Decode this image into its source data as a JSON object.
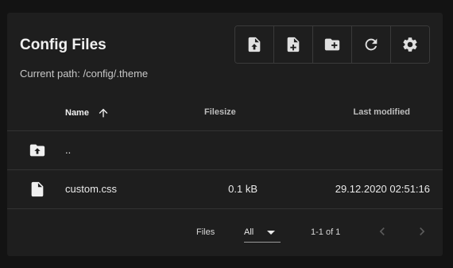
{
  "header": {
    "title": "Config Files",
    "current_path": "Current path: /config/.theme"
  },
  "toolbar": {
    "buttons": [
      {
        "name": "upload-file",
        "icon": "file-upload-icon"
      },
      {
        "name": "new-file",
        "icon": "file-plus-icon"
      },
      {
        "name": "new-folder",
        "icon": "folder-plus-icon"
      },
      {
        "name": "refresh",
        "icon": "refresh-icon"
      },
      {
        "name": "settings",
        "icon": "gear-icon"
      }
    ]
  },
  "table": {
    "columns": {
      "name": "Name",
      "filesize": "Filesize",
      "last_modified": "Last modified"
    },
    "sort": {
      "column": "name",
      "direction": "ascending",
      "icon": "arrow-up-icon"
    },
    "rows": [
      {
        "type": "folder-up",
        "icon": "folder-up-icon",
        "name": "..",
        "filesize": "",
        "last_modified": ""
      },
      {
        "type": "file",
        "icon": "file-icon",
        "name": "custom.css",
        "filesize": "0.1 kB",
        "last_modified": "29.12.2020 02:51:16"
      }
    ]
  },
  "pagination": {
    "label": "Files",
    "per_page_selected": "All",
    "range": "1-1 of 1",
    "prev_icon": "chevron-left-icon",
    "next_icon": "chevron-right-icon"
  },
  "colors": {
    "background": "#131313",
    "card": "#1e1e1e",
    "divider": "#333333",
    "text": "#e8e8e8",
    "disabled": "#5c5c5c"
  }
}
